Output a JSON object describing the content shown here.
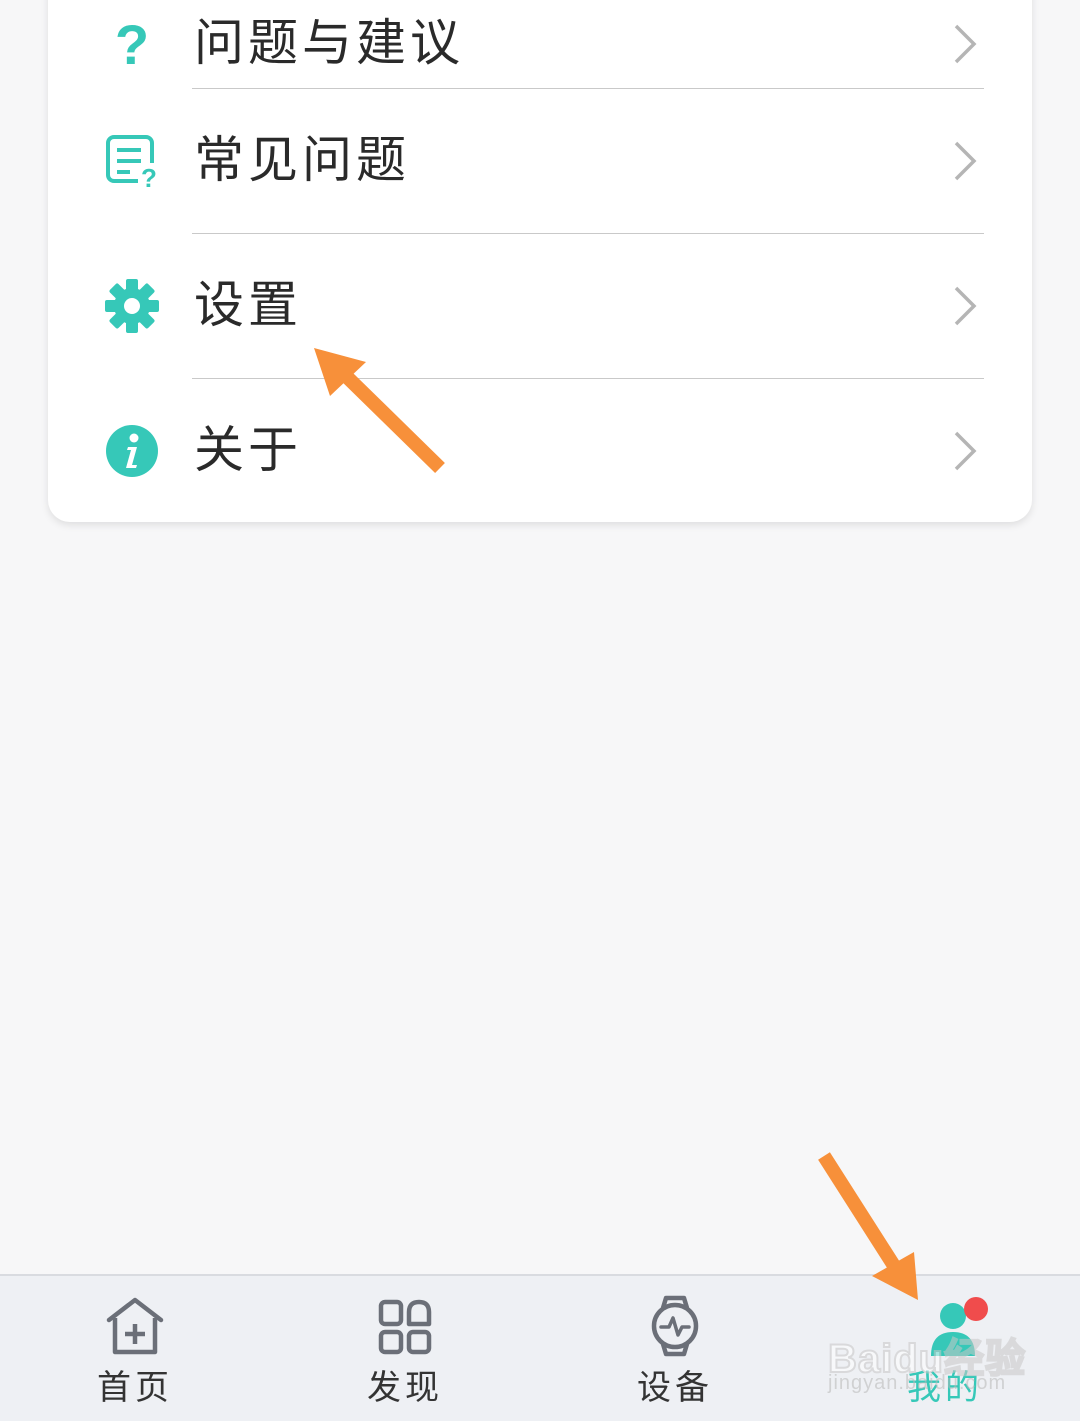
{
  "menu": {
    "items": [
      {
        "label": "问题与建议",
        "icon": "question-icon"
      },
      {
        "label": "常见问题",
        "icon": "faq-icon"
      },
      {
        "label": "设置",
        "icon": "gear-icon"
      },
      {
        "label": "关于",
        "icon": "info-icon"
      }
    ]
  },
  "tabbar": {
    "items": [
      {
        "label": "首页",
        "icon": "home-icon",
        "active": false
      },
      {
        "label": "发现",
        "icon": "discover-icon",
        "active": false
      },
      {
        "label": "设备",
        "icon": "watch-icon",
        "active": false
      },
      {
        "label": "我的",
        "icon": "profile-icon",
        "active": true
      }
    ]
  },
  "watermark": {
    "brand": "Baidu经验",
    "url": "jingyan.baidu.com"
  },
  "colors": {
    "accent": "#36c8b8",
    "annotation_arrow": "#f7903a",
    "notification_dot": "#f04c4c",
    "chevron": "#b5b5b5"
  }
}
